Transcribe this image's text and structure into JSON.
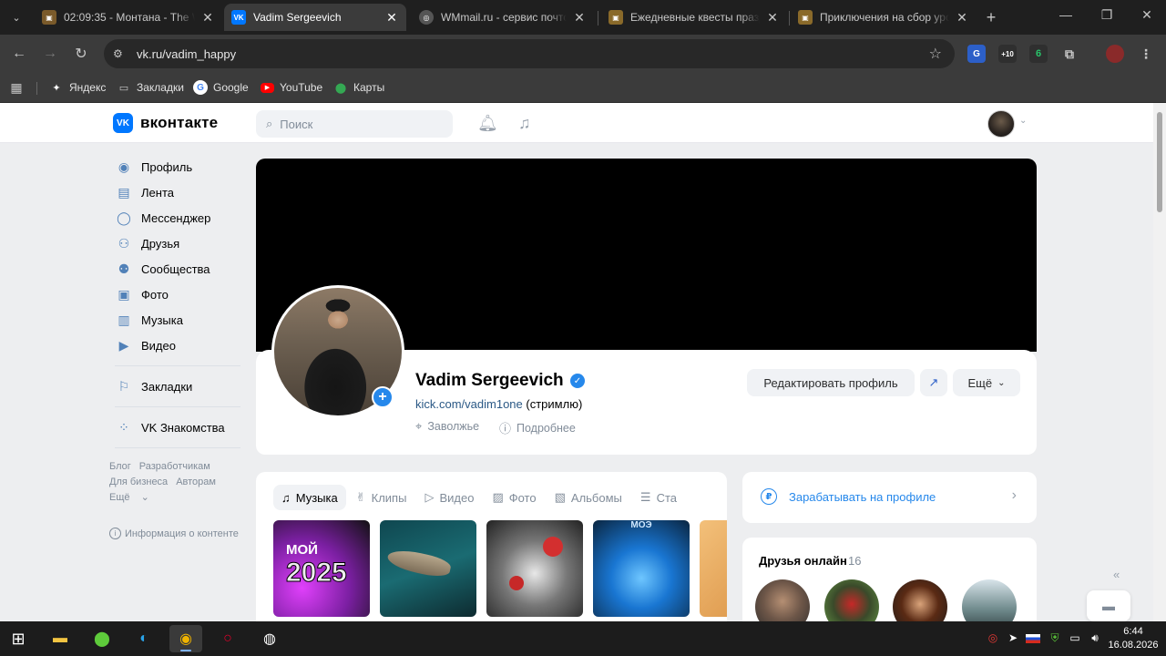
{
  "browser": {
    "tabs": [
      {
        "title": "02:09:35 - Монтана - The W",
        "active": false
      },
      {
        "title": "Vadim Sergeevich",
        "active": true
      },
      {
        "title": "WMmail.ru - сервис почтов",
        "active": false
      },
      {
        "title": "Ежедневные квесты празд",
        "active": false
      },
      {
        "title": "Приключения на сбор уро",
        "active": false
      }
    ],
    "url": "vk.ru/vadim_happy",
    "extension_badge": "+10",
    "extension_badge2": "6",
    "bookmarks": [
      {
        "label": "Яндекс",
        "icon": "sparkle-icon"
      },
      {
        "label": "Закладки",
        "icon": "folder-icon"
      },
      {
        "label": "Google",
        "icon": "google-icon"
      },
      {
        "label": "YouTube",
        "icon": "youtube-icon"
      },
      {
        "label": "Карты",
        "icon": "map-pin-icon"
      }
    ]
  },
  "vk": {
    "logo_text": "вконтакте",
    "logo_mark": "VK",
    "search_placeholder": "Поиск",
    "nav": [
      {
        "label": "Профиль",
        "icon": "user-circle-icon"
      },
      {
        "label": "Лента",
        "icon": "feed-icon"
      },
      {
        "label": "Мессенджер",
        "icon": "chat-icon"
      },
      {
        "label": "Друзья",
        "icon": "friends-icon"
      },
      {
        "label": "Сообщества",
        "icon": "communities-icon"
      },
      {
        "label": "Фото",
        "icon": "photo-icon"
      },
      {
        "label": "Музыка",
        "icon": "music-icon"
      },
      {
        "label": "Видео",
        "icon": "video-icon"
      }
    ],
    "nav2": [
      {
        "label": "Закладки",
        "icon": "bookmark-icon"
      }
    ],
    "nav3": [
      {
        "label": "VK Знакомства",
        "icon": "dating-icon"
      }
    ],
    "footer": {
      "blog": "Блог",
      "developers": "Разработчикам",
      "business": "Для бизнеса",
      "ads": "Авторам",
      "more": "Ещё",
      "info": "Информация о контенте"
    },
    "profile": {
      "name": "Vadim Sergeevich",
      "status_link": "kick.com/vadim1one",
      "status_rest": " (стримлю)",
      "location": "Заволжье",
      "details": "Подробнее",
      "edit_button": "Редактировать профиль",
      "more_button": "Ещё"
    },
    "content_tabs": [
      {
        "label": "Музыка",
        "icon": "music-note-icon",
        "active": true
      },
      {
        "label": "Клипы",
        "icon": "clips-icon",
        "active": false
      },
      {
        "label": "Видео",
        "icon": "video-play-icon",
        "active": false
      },
      {
        "label": "Фото",
        "icon": "image-icon",
        "active": false
      },
      {
        "label": "Альбомы",
        "icon": "albums-icon",
        "active": false
      },
      {
        "label": "Ста",
        "icon": "articles-icon",
        "active": false
      }
    ],
    "tile1": {
      "line1": "МОЙ",
      "line2": "2025"
    },
    "tile4": {
      "label": "МОЭ"
    },
    "earn": "Зарабатывать на профиле",
    "friends_online": {
      "title": "Друзья онлайн",
      "count": "16"
    }
  },
  "taskbar": {
    "time": "6:44",
    "date": "16.08.2026"
  }
}
